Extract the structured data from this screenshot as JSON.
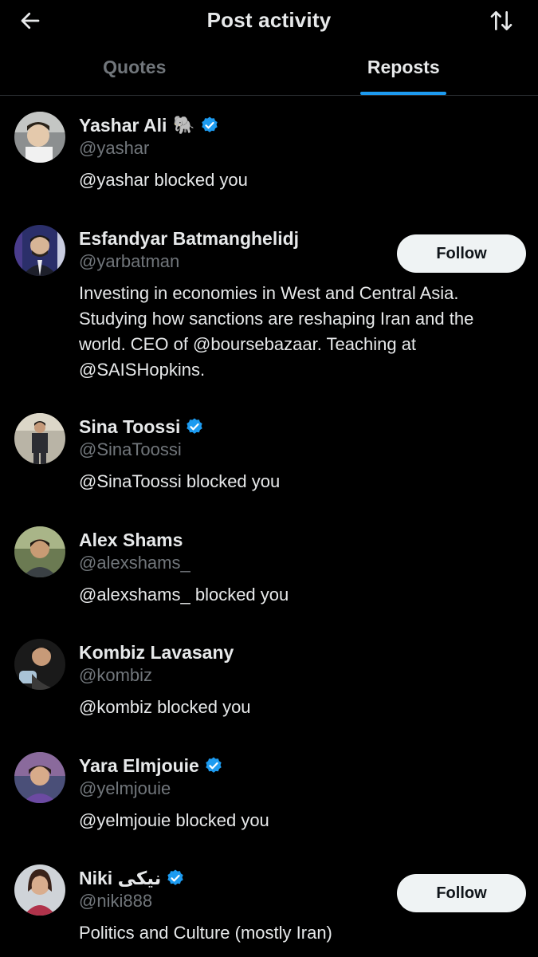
{
  "header": {
    "title": "Post activity",
    "back_icon": "arrow-left-icon",
    "sort_icon": "sort-arrows-icon"
  },
  "tabs": [
    {
      "label": "Quotes",
      "active": false
    },
    {
      "label": "Reposts",
      "active": true
    }
  ],
  "colors": {
    "background": "#000000",
    "text": "#e7e9ea",
    "muted": "#71767b",
    "accent": "#1d9bf0",
    "button_bg": "#eff3f4"
  },
  "users": [
    {
      "name": "Yashar Ali",
      "emoji": "🐘",
      "verified": true,
      "handle": "@yashar",
      "bio": "@yashar blocked you",
      "follow": null
    },
    {
      "name": "Esfandyar Batmanghelidj",
      "verified": false,
      "handle": "@yarbatman",
      "bio": "Investing in economies in West and Central Asia. Studying how sanctions are reshaping Iran and the world. CEO of @boursebazaar. Teaching at @SAISHopkins.",
      "follow": "Follow"
    },
    {
      "name": "Sina Toossi",
      "verified": true,
      "handle": "@SinaToossi",
      "bio": "@SinaToossi blocked you",
      "follow": null
    },
    {
      "name": "Alex Shams",
      "verified": false,
      "handle": "@alexshams_",
      "bio": "@alexshams_ blocked you",
      "follow": null
    },
    {
      "name": "Kombiz Lavasany",
      "verified": false,
      "handle": "@kombiz",
      "bio": "@kombiz blocked you",
      "follow": null
    },
    {
      "name": "Yara Elmjouie",
      "verified": true,
      "handle": "@yelmjouie",
      "bio": "@yelmjouie blocked you",
      "follow": null
    },
    {
      "name": "Niki نیکی",
      "verified": true,
      "handle": "@niki888",
      "bio": "Politics and Culture (mostly Iran)",
      "follow": "Follow"
    }
  ]
}
